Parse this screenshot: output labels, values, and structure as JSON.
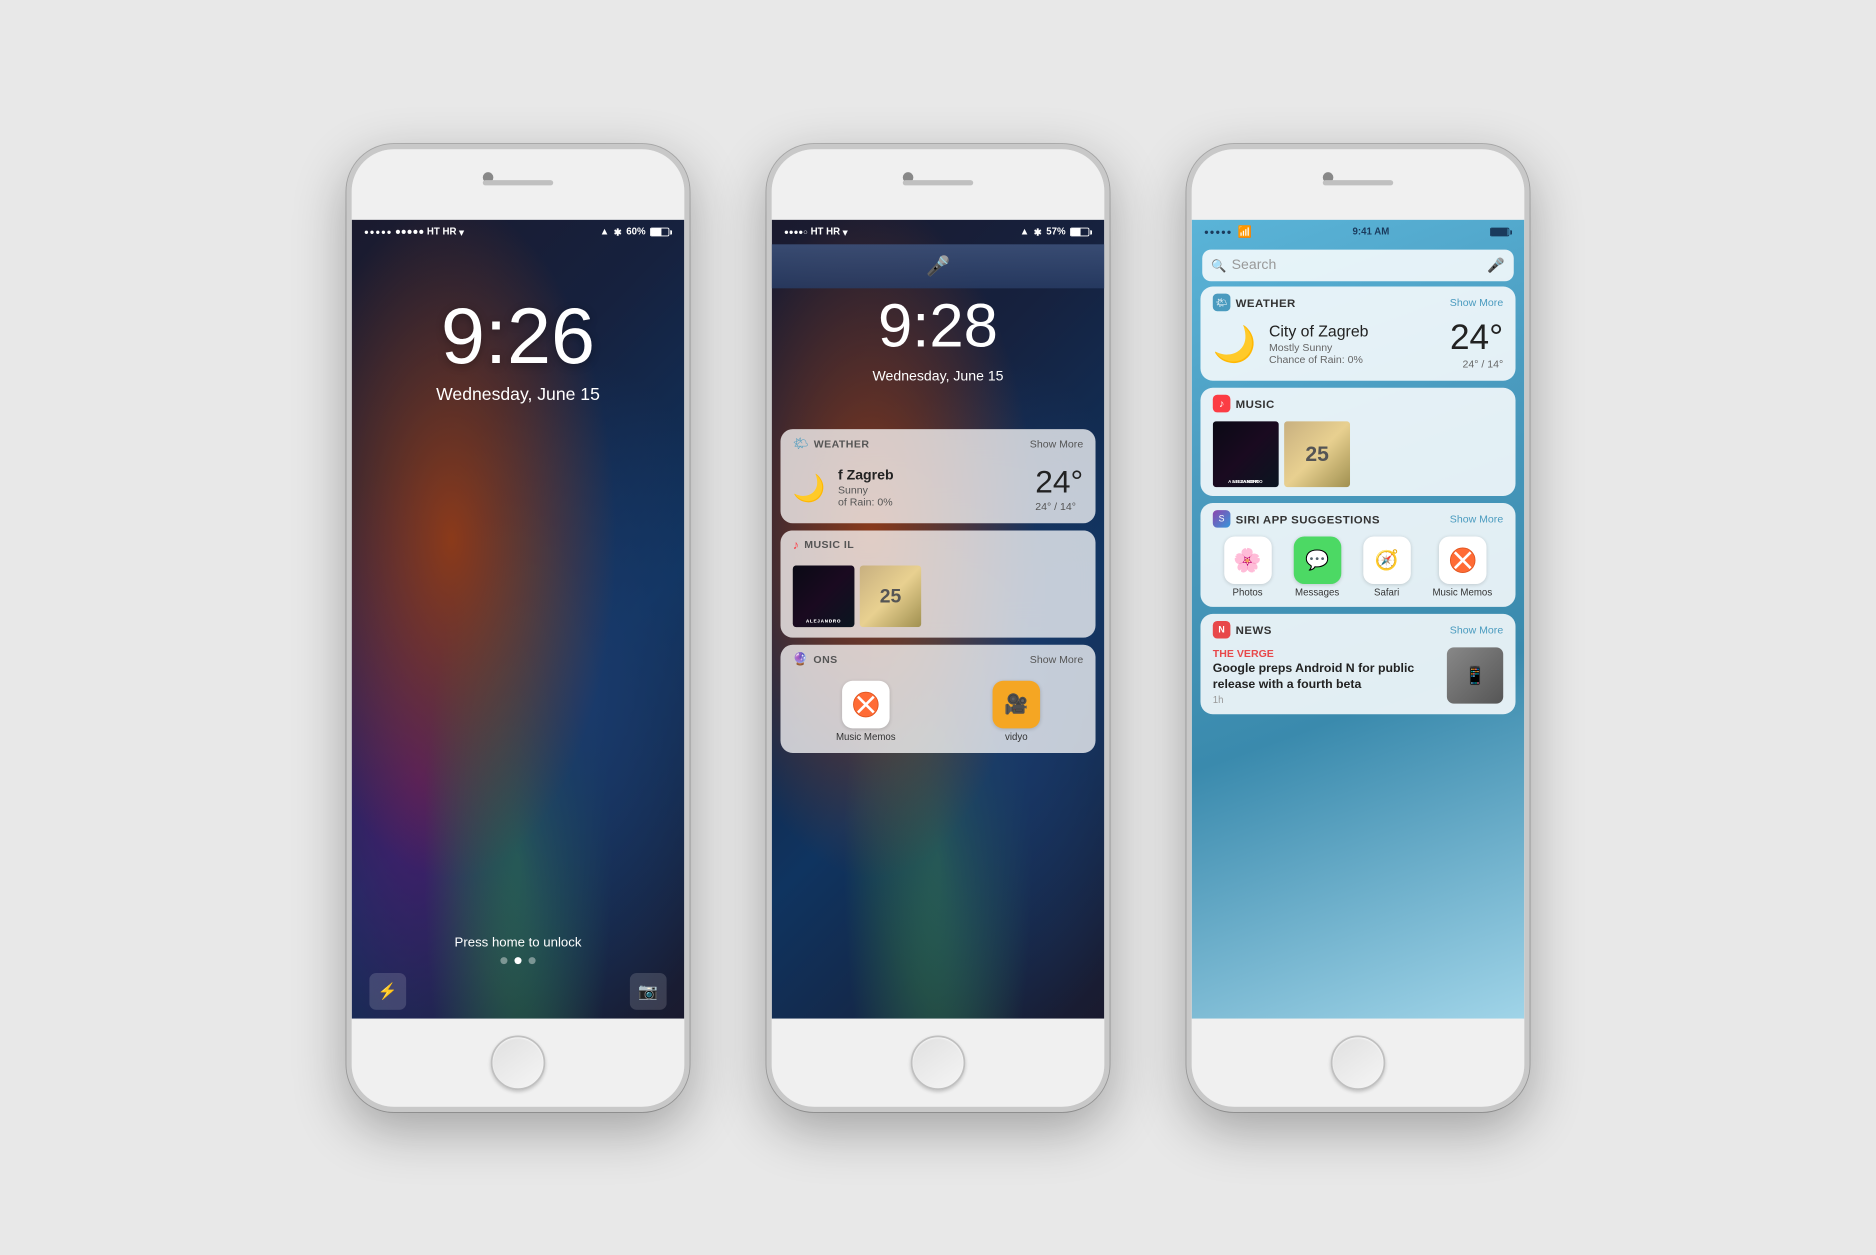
{
  "phones": [
    {
      "id": "phone1",
      "type": "lockscreen",
      "status_bar": {
        "carrier": "●●●●● HT HR",
        "wifi": "▾",
        "time": "",
        "location": "▲",
        "bluetooth": "⊛",
        "battery_percent": "60%",
        "battery_level": 60
      },
      "lock_time": "9:26",
      "lock_date": "Wednesday, June 15",
      "press_home_text": "Press home to unlock"
    },
    {
      "id": "phone2",
      "type": "notification_center",
      "status_bar": {
        "carrier": "●●●●○ HT HR",
        "time": "",
        "battery_percent": "57%",
        "battery_level": 57
      },
      "lock_time": "9:28",
      "lock_date": "Wednesday, June 15",
      "weather_widget": {
        "title": "WEATHER",
        "show_more": "Show More",
        "city": "f Zagreb",
        "description": "Sunny",
        "rain_chance": "of Rain: 0%",
        "temperature": "24°",
        "range": "24° / 14°"
      },
      "music_widget": {
        "title": "MUSIC",
        "album1_label": "ALEJANDRO",
        "album2_label": "25"
      },
      "siri_widget": {
        "title": "ONS",
        "show_more": "Show More",
        "apps": [
          {
            "name": "Music Memos",
            "type": "music-memos"
          },
          {
            "name": "vidyo",
            "type": "vidyo"
          }
        ]
      }
    },
    {
      "id": "phone3",
      "type": "today_view",
      "status_bar": {
        "carrier": "●●●●● ",
        "wifi": "wifi",
        "time": "9:41 AM",
        "battery_level": 100
      },
      "search": {
        "placeholder": "Search",
        "mic_icon": "mic"
      },
      "weather_widget": {
        "section_title": "WEATHER",
        "show_more": "Show More",
        "city": "City of Zagreb",
        "description": "Mostly Sunny",
        "rain_chance": "Chance of Rain: 0%",
        "temperature": "24°",
        "range": "24° / 14°"
      },
      "music_widget": {
        "section_title": "MUSIC",
        "album1_label": "ALEJANDRO",
        "album2_label": "25"
      },
      "siri_widget": {
        "section_title": "SIRI APP SUGGESTIONS",
        "show_more": "Show More",
        "apps": [
          {
            "name": "Photos",
            "type": "photos"
          },
          {
            "name": "Messages",
            "type": "messages"
          },
          {
            "name": "Safari",
            "type": "safari"
          },
          {
            "name": "Music Memos",
            "type": "music-memos"
          }
        ]
      },
      "news_widget": {
        "section_title": "NEWS",
        "show_more": "Show More",
        "source": "THE VERGE",
        "headline": "Google preps Android N for public release with a fourth beta",
        "time": "1h"
      }
    }
  ]
}
